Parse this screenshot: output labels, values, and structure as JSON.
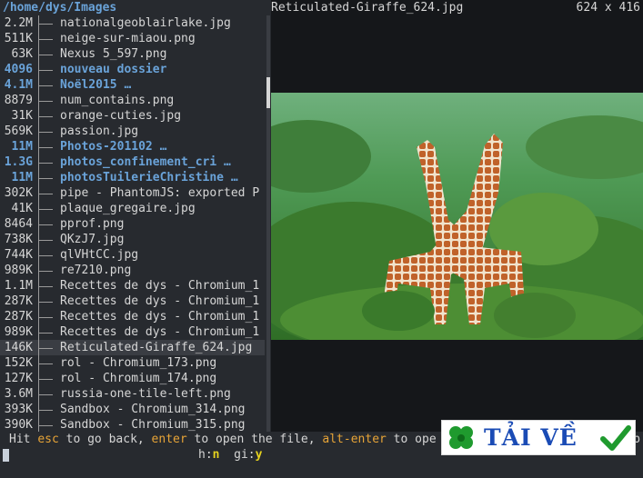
{
  "path": "/home/dys/Images",
  "files": [
    {
      "size": "2.2M",
      "name": "nationalgeoblairlake.jpg",
      "dir": false
    },
    {
      "size": "511K",
      "name": "neige-sur-miaou.png",
      "dir": false
    },
    {
      "size": "63K",
      "name": "Nexus 5_597.png",
      "dir": false
    },
    {
      "size": "4096",
      "name": "nouveau dossier",
      "dir": true
    },
    {
      "size": "4.1M",
      "name": "Noël2015 …",
      "dir": true
    },
    {
      "size": "8879",
      "name": "num_contains.png",
      "dir": false
    },
    {
      "size": "31K",
      "name": "orange-cuties.jpg",
      "dir": false
    },
    {
      "size": "569K",
      "name": "passion.jpg",
      "dir": false
    },
    {
      "size": "11M",
      "name": "Photos-201102 …",
      "dir": true
    },
    {
      "size": "1.3G",
      "name": "photos_confinement_cri …",
      "dir": true
    },
    {
      "size": "11M",
      "name": "photosTuilerieChristine …",
      "dir": true
    },
    {
      "size": "302K",
      "name": "pipe - PhantomJS: exported P",
      "dir": false
    },
    {
      "size": "41K",
      "name": "plaque_gregaire.jpg",
      "dir": false
    },
    {
      "size": "8464",
      "name": "pprof.png",
      "dir": false
    },
    {
      "size": "738K",
      "name": "QKzJ7.jpg",
      "dir": false
    },
    {
      "size": "744K",
      "name": "qlVHtCC.jpg",
      "dir": false
    },
    {
      "size": "989K",
      "name": "re7210.png",
      "dir": false
    },
    {
      "size": "1.1M",
      "name": "Recettes de dys - Chromium_1",
      "dir": false
    },
    {
      "size": "287K",
      "name": "Recettes de dys - Chromium_1",
      "dir": false
    },
    {
      "size": "287K",
      "name": "Recettes de dys - Chromium_1",
      "dir": false
    },
    {
      "size": "989K",
      "name": "Recettes de dys - Chromium_1",
      "dir": false
    },
    {
      "size": "146K",
      "name": "Reticulated-Giraffe_624.jpg",
      "dir": false,
      "selected": true
    },
    {
      "size": "152K",
      "name": "rol - Chromium_173.png",
      "dir": false
    },
    {
      "size": "127K",
      "name": "rol - Chromium_174.png",
      "dir": false
    },
    {
      "size": "3.6M",
      "name": "russia-one-tile-left.png",
      "dir": false
    },
    {
      "size": "393K",
      "name": "Sandbox - Chromium_314.png",
      "dir": false
    },
    {
      "size": "390K",
      "name": "Sandbox - Chromium_315.png",
      "dir": false
    }
  ],
  "preview": {
    "title": "Reticulated-Giraffe_624.jpg",
    "dimensions": "624 x 416"
  },
  "status": {
    "p1": "Hit ",
    "k1": "esc",
    "p2": " to go back, ",
    "k2": "enter",
    "p3": " to open the file, ",
    "k3": "alt-enter",
    "p4": " to ope",
    "tail": "b"
  },
  "bottom": {
    "h_label": "h:",
    "h_value": "n",
    "gi_label": "gi:",
    "gi_value": "y"
  },
  "badge": {
    "text": "TẢI VỀ"
  },
  "colors": {
    "dir": "#6aa3d9",
    "key": "#e7a437",
    "hint_value": "#e6d21e",
    "background": "#272a2f"
  }
}
